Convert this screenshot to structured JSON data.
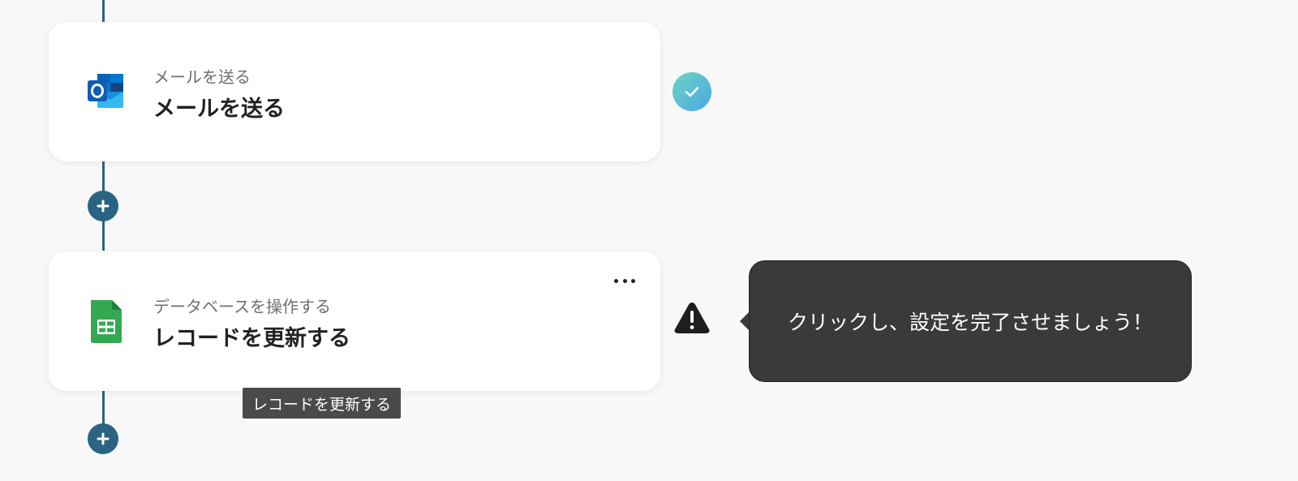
{
  "steps": [
    {
      "app_icon": "outlook-icon",
      "subtitle": "メールを送る",
      "title": "メールを送る",
      "status": "complete",
      "status_icon": "check-icon"
    },
    {
      "app_icon": "google-sheets-icon",
      "subtitle": "データベースを操作する",
      "title": "レコードを更新する",
      "status": "incomplete",
      "status_icon": "warning-icon"
    }
  ],
  "tooltip": {
    "text": "クリックし、設定を完了させましょう！"
  },
  "hover_tip": {
    "text": "レコードを更新する"
  },
  "colors": {
    "connector": "#2a6482",
    "tooltip_bg": "#3a3a3a",
    "check_gradient_start": "#6ed3c4",
    "check_gradient_end": "#4aa9e3",
    "sheets_green": "#34a853"
  }
}
